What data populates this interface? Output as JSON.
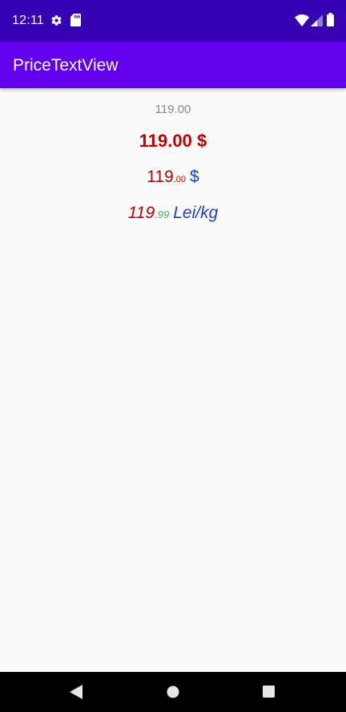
{
  "status_bar": {
    "time": "12:11",
    "icons": [
      "gear-icon",
      "sd-card-icon",
      "wifi-icon",
      "cell-signal-icon",
      "battery-icon"
    ]
  },
  "app_bar": {
    "title": "PriceTextView"
  },
  "prices": {
    "row1": {
      "text": "119.00"
    },
    "row2": {
      "text": "119.00 $"
    },
    "row3": {
      "integer": "119",
      "decimal": ".00",
      "currency": "$"
    },
    "row4": {
      "integer": "119",
      "decimal": ".99",
      "currency": "Lei/kg"
    }
  },
  "nav_bar": {
    "icons": [
      "back-icon",
      "home-icon",
      "recents-icon"
    ]
  },
  "colors": {
    "status_bar": "#3700b3",
    "app_bar": "#6200ee",
    "price_red": "#c00000",
    "price_blue": "#1a3fd6",
    "price_green": "#4caf50",
    "price_gray": "#8a8a8a"
  }
}
